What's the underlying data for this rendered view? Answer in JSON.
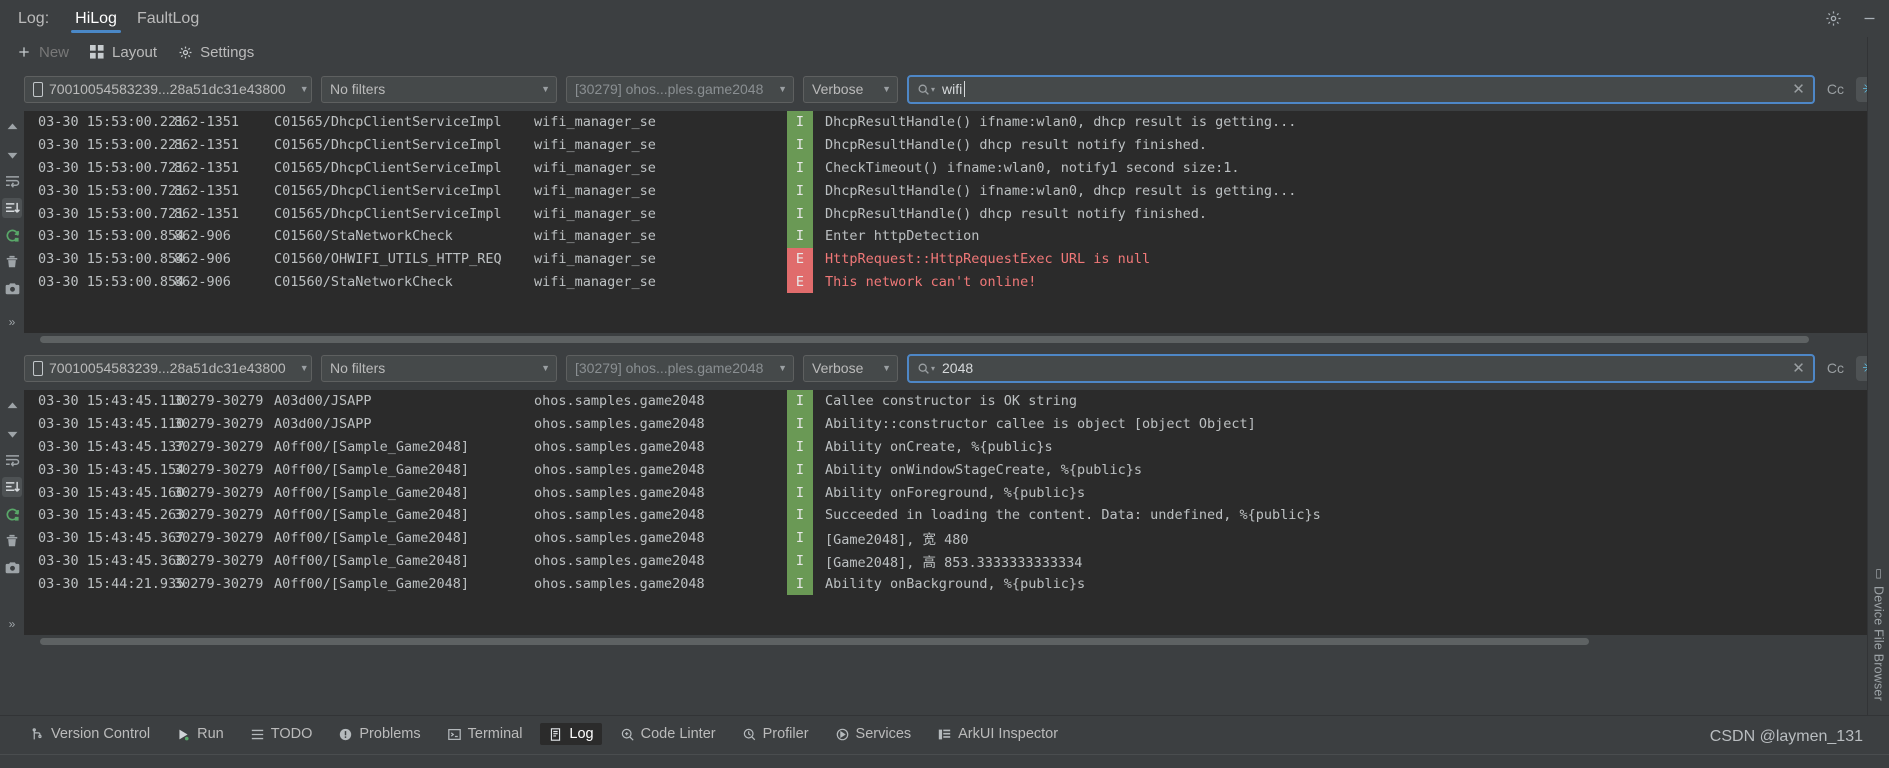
{
  "titlebar": {
    "log_label": "Log:",
    "tabs": [
      {
        "label": "HiLog",
        "active": true
      },
      {
        "label": "FaultLog",
        "active": false
      }
    ],
    "settings_icon": "gear-icon",
    "minimize_icon": "minimize-icon"
  },
  "toolbar": {
    "new_label": "New",
    "layout_label": "Layout",
    "settings_label": "Settings"
  },
  "panels": [
    {
      "id": "panel-wifi",
      "filters": {
        "device": "70010054583239...28a51dc31e43800",
        "filter": "No filters",
        "process": "[30279] ohos...ples.game2048",
        "level": "Verbose",
        "search_value": "wifi",
        "cc_label": "Cc",
        "star_label": "✳"
      },
      "rows": [
        {
          "time": "03-30 15:53:00.221",
          "pid": "862-1351",
          "tag": "C01565/DhcpClientServiceImpl",
          "pkg": "wifi_manager_se",
          "level": "I",
          "msg": "DhcpResultHandle() ifname:wlan0, dhcp result is getting..."
        },
        {
          "time": "03-30 15:53:00.221",
          "pid": "862-1351",
          "tag": "C01565/DhcpClientServiceImpl",
          "pkg": "wifi_manager_se",
          "level": "I",
          "msg": "DhcpResultHandle() dhcp result notify finished."
        },
        {
          "time": "03-30 15:53:00.721",
          "pid": "862-1351",
          "tag": "C01565/DhcpClientServiceImpl",
          "pkg": "wifi_manager_se",
          "level": "I",
          "msg": "CheckTimeout() ifname:wlan0, notify1 second size:1."
        },
        {
          "time": "03-30 15:53:00.721",
          "pid": "862-1351",
          "tag": "C01565/DhcpClientServiceImpl",
          "pkg": "wifi_manager_se",
          "level": "I",
          "msg": "DhcpResultHandle() ifname:wlan0, dhcp result is getting..."
        },
        {
          "time": "03-30 15:53:00.721",
          "pid": "862-1351",
          "tag": "C01565/DhcpClientServiceImpl",
          "pkg": "wifi_manager_se",
          "level": "I",
          "msg": "DhcpResultHandle() dhcp result notify finished."
        },
        {
          "time": "03-30 15:53:00.854",
          "pid": "862-906",
          "tag": "C01560/StaNetworkCheck",
          "pkg": "wifi_manager_se",
          "level": "I",
          "msg": "Enter httpDetection"
        },
        {
          "time": "03-30 15:53:00.854",
          "pid": "862-906",
          "tag": "C01560/OHWIFI_UTILS_HTTP_REQ",
          "pkg": "wifi_manager_se",
          "level": "E",
          "msg": "HttpRequest::HttpRequestExec URL is null"
        },
        {
          "time": "03-30 15:53:00.854",
          "pid": "862-906",
          "tag": "C01560/StaNetworkCheck",
          "pkg": "wifi_manager_se",
          "level": "E",
          "msg": "This network can't online!"
        }
      ]
    },
    {
      "id": "panel-2048",
      "filters": {
        "device": "70010054583239...28a51dc31e43800",
        "filter": "No filters",
        "process": "[30279] ohos...ples.game2048",
        "level": "Verbose",
        "search_value": "2048",
        "cc_label": "Cc",
        "star_label": "✳"
      },
      "rows": [
        {
          "time": "03-30 15:43:45.110",
          "pid": "30279-30279",
          "tag": "A03d00/JSAPP",
          "pkg": "ohos.samples.game2048",
          "level": "I",
          "msg": "Callee constructor is OK string"
        },
        {
          "time": "03-30 15:43:45.110",
          "pid": "30279-30279",
          "tag": "A03d00/JSAPP",
          "pkg": "ohos.samples.game2048",
          "level": "I",
          "msg": "Ability::constructor callee is object [object Object]"
        },
        {
          "time": "03-30 15:43:45.137",
          "pid": "30279-30279",
          "tag": "A0ff00/[Sample_Game2048]",
          "pkg": "ohos.samples.game2048",
          "level": "I",
          "msg": "Ability onCreate, %{public}s"
        },
        {
          "time": "03-30 15:43:45.154",
          "pid": "30279-30279",
          "tag": "A0ff00/[Sample_Game2048]",
          "pkg": "ohos.samples.game2048",
          "level": "I",
          "msg": "Ability onWindowStageCreate, %{public}s"
        },
        {
          "time": "03-30 15:43:45.160",
          "pid": "30279-30279",
          "tag": "A0ff00/[Sample_Game2048]",
          "pkg": "ohos.samples.game2048",
          "level": "I",
          "msg": "Ability onForeground, %{public}s"
        },
        {
          "time": "03-30 15:43:45.263",
          "pid": "30279-30279",
          "tag": "A0ff00/[Sample_Game2048]",
          "pkg": "ohos.samples.game2048",
          "level": "I",
          "msg": "Succeeded in loading the content. Data: undefined, %{public}s"
        },
        {
          "time": "03-30 15:43:45.367",
          "pid": "30279-30279",
          "tag": "A0ff00/[Sample_Game2048]",
          "pkg": "ohos.samples.game2048",
          "level": "I",
          "msg": "[Game2048], 宽 480"
        },
        {
          "time": "03-30 15:43:45.368",
          "pid": "30279-30279",
          "tag": "A0ff00/[Sample_Game2048]",
          "pkg": "ohos.samples.game2048",
          "level": "I",
          "msg": "[Game2048], 高 853.3333333333334"
        },
        {
          "time": "03-30 15:44:21.935",
          "pid": "30279-30279",
          "tag": "A0ff00/[Sample_Game2048]",
          "pkg": "ohos.samples.game2048",
          "level": "I",
          "msg": "Ability onBackground, %{public}s"
        }
      ]
    }
  ],
  "gutter_icons": [
    "arrow-up-icon",
    "arrow-down-icon",
    "soft-wrap-icon",
    "scroll-to-end-icon",
    "restart-icon",
    "trash-icon",
    "camera-icon"
  ],
  "gutter_expand": "»",
  "right_rail": {
    "label": "Device File Browser"
  },
  "statusbar": {
    "items": [
      {
        "label": "Version Control",
        "icon": "branch-icon",
        "active": false
      },
      {
        "label": "Run",
        "icon": "run-icon",
        "active": false
      },
      {
        "label": "TODO",
        "icon": "todo-icon",
        "active": false
      },
      {
        "label": "Problems",
        "icon": "problems-icon",
        "active": false
      },
      {
        "label": "Terminal",
        "icon": "terminal-icon",
        "active": false
      },
      {
        "label": "Log",
        "icon": "log-icon",
        "active": true
      },
      {
        "label": "Code Linter",
        "icon": "linter-icon",
        "active": false
      },
      {
        "label": "Profiler",
        "icon": "profiler-icon",
        "active": false
      },
      {
        "label": "Services",
        "icon": "services-icon",
        "active": false
      },
      {
        "label": "ArkUI Inspector",
        "icon": "inspector-icon",
        "active": false
      }
    ],
    "watermark": "CSDN @laymen_131"
  },
  "colors": {
    "accent": "#4e87c7",
    "info_level_bg": "#6a9955",
    "error_level_bg": "#e06c6c",
    "error_text": "#f07878",
    "panel_bg": "#3c3f41",
    "log_bg": "#2b2b2b"
  }
}
